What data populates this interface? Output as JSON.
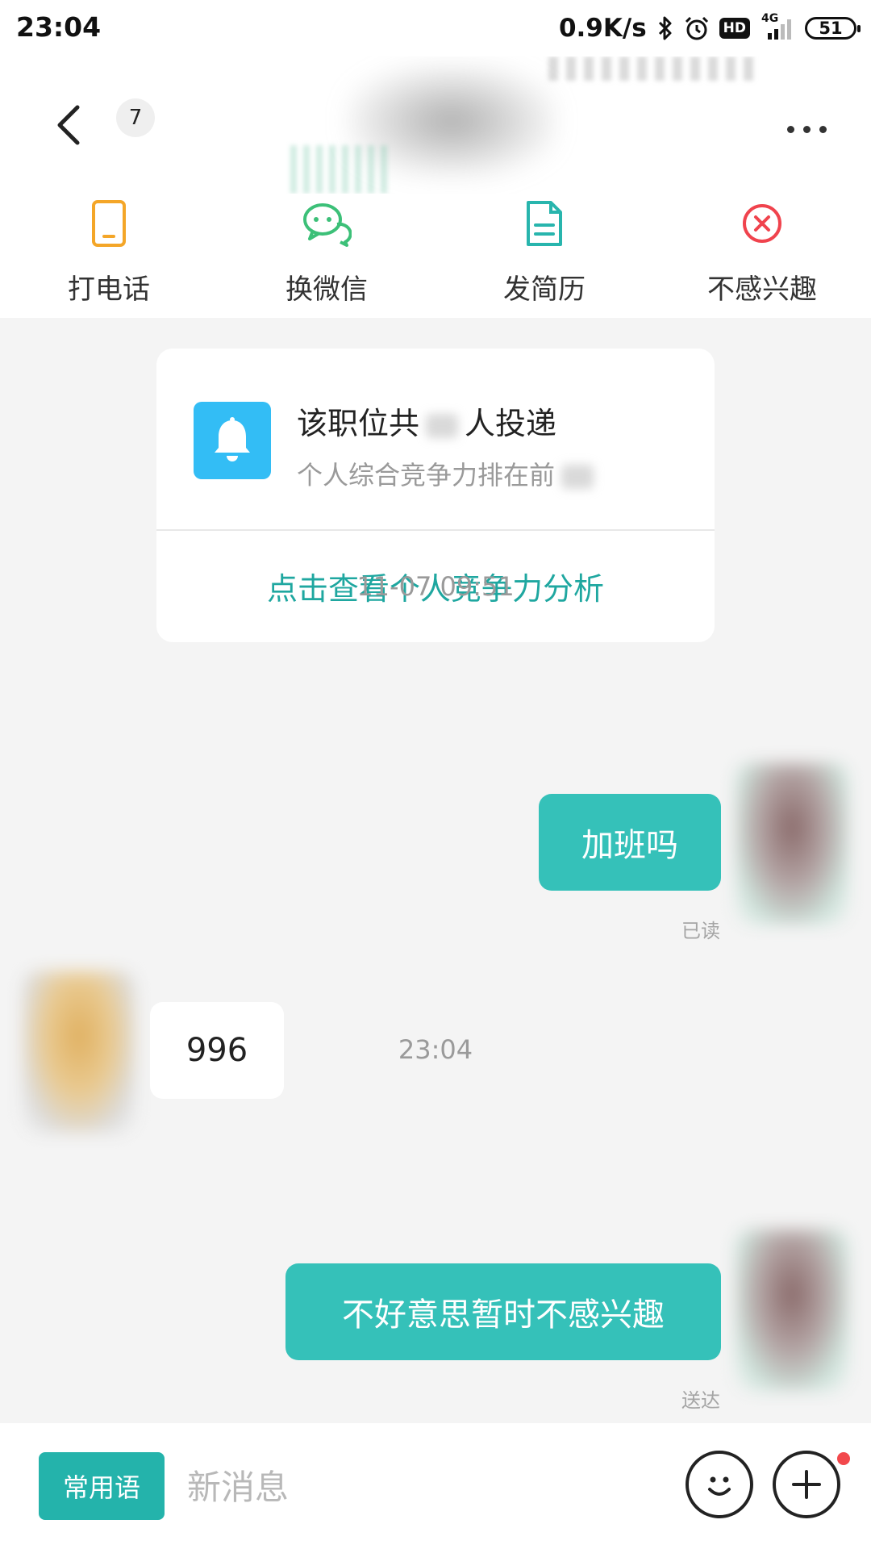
{
  "status_bar": {
    "time": "23:04",
    "net_speed": "0.9K/s",
    "hd_label": "HD",
    "network": "4G",
    "battery": "51"
  },
  "header": {
    "unread_count": "7",
    "actions": [
      {
        "label": "打电话",
        "icon": "phone-icon",
        "color": "#f4a628"
      },
      {
        "label": "换微信",
        "icon": "wechat-icon",
        "color": "#3cc078"
      },
      {
        "label": "发简历",
        "icon": "resume-icon",
        "color": "#28b5ad"
      },
      {
        "label": "不感兴趣",
        "icon": "not-interested-icon",
        "color": "#f0434d"
      }
    ]
  },
  "notice_card": {
    "title_prefix": "该职位共",
    "title_suffix": "人投递",
    "subtitle": "个人综合竞争力排在前",
    "link": "点击查看个人竞争力分析",
    "icon": "bell-icon",
    "icon_bg": "#33bdf5"
  },
  "messages": [
    {
      "type": "timestamp",
      "text": "11-07 09:51"
    },
    {
      "type": "sent",
      "text": "加班吗",
      "receipt": "已读"
    },
    {
      "type": "received",
      "text": "996"
    },
    {
      "type": "timestamp",
      "text": "23:04"
    },
    {
      "type": "sent",
      "text": "不好意思暂时不感兴趣",
      "receipt": "送达"
    }
  ],
  "bottom_bar": {
    "quick_phrases_label": "常用语",
    "input_placeholder": "新消息",
    "emoji_icon": "emoji-icon",
    "plus_icon": "plus-icon"
  },
  "colors": {
    "accent": "#35c1b9",
    "link": "#1fa7a0",
    "background": "#f4f4f4"
  }
}
